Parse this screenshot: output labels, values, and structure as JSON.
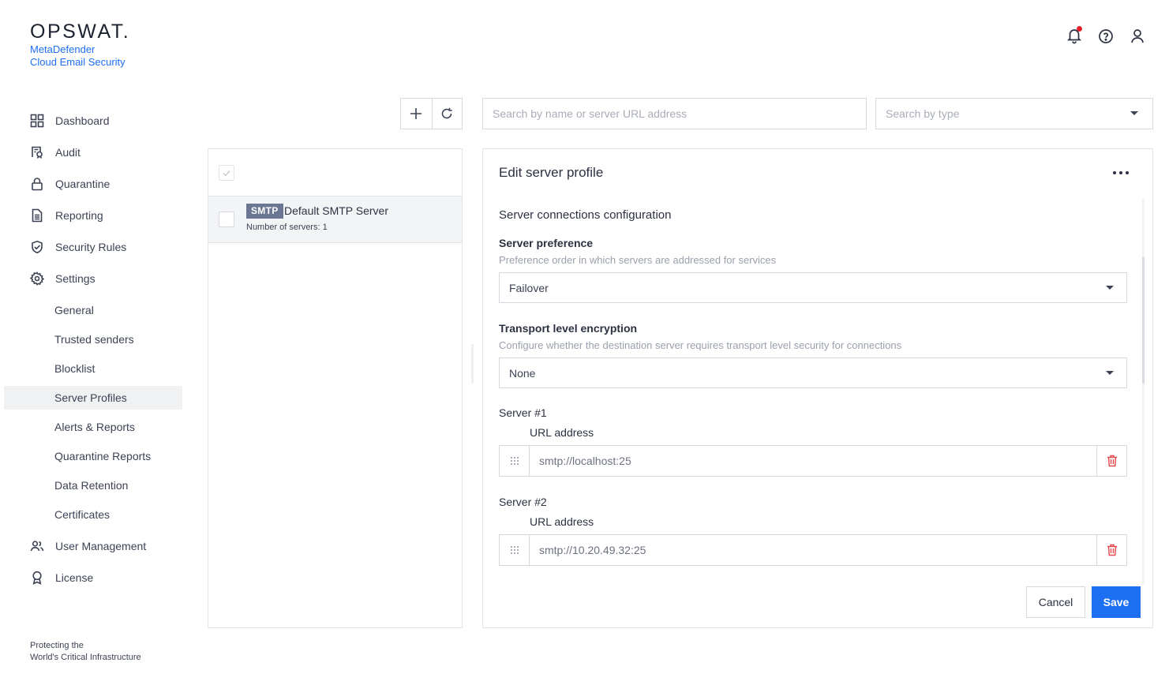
{
  "brand": {
    "logo": "OPSWAT.",
    "product_line1": "MetaDefender",
    "product_line2": "Cloud Email Security"
  },
  "nav": {
    "items": [
      {
        "label": "Dashboard",
        "icon": "dashboard-icon"
      },
      {
        "label": "Audit",
        "icon": "audit-icon"
      },
      {
        "label": "Quarantine",
        "icon": "lock-icon"
      },
      {
        "label": "Reporting",
        "icon": "document-icon"
      },
      {
        "label": "Security Rules",
        "icon": "shield-check-icon"
      },
      {
        "label": "Settings",
        "icon": "gear-icon"
      },
      {
        "label": "User Management",
        "icon": "users-icon"
      },
      {
        "label": "License",
        "icon": "award-icon"
      }
    ],
    "settings_sub": [
      "General",
      "Trusted senders",
      "Blocklist",
      "Server Profiles",
      "Alerts & Reports",
      "Quarantine Reports",
      "Data Retention",
      "Certificates"
    ],
    "active_sub": "Server Profiles"
  },
  "footer": {
    "line1": "Protecting the",
    "line2": "World's Critical Infrastructure"
  },
  "search": {
    "placeholder": "Search by name or server URL address",
    "type_placeholder": "Search by type"
  },
  "list": {
    "rows": [
      {
        "badge": "SMTP",
        "title": "Default SMTP Server",
        "subtitle": "Number of servers: 1"
      }
    ]
  },
  "edit": {
    "title": "Edit server profile",
    "section_title": "Server connections configuration",
    "preference": {
      "label": "Server preference",
      "help": "Preference order in which servers are addressed for services",
      "value": "Failover"
    },
    "encryption": {
      "label": "Transport level encryption",
      "help": "Configure whether the destination server requires transport level security for connections",
      "value": "None"
    },
    "servers": [
      {
        "label": "Server #1",
        "url_label": "URL address",
        "url": "smtp://localhost:25"
      },
      {
        "label": "Server #2",
        "url_label": "URL address",
        "url": "smtp://10.20.49.32:25"
      }
    ],
    "cancel_label": "Cancel",
    "save_label": "Save"
  },
  "colors": {
    "accent": "#1d6ff2",
    "badge": "#6b7693",
    "notification_dot": "#e4212b",
    "danger_icon": "#e5484d"
  }
}
